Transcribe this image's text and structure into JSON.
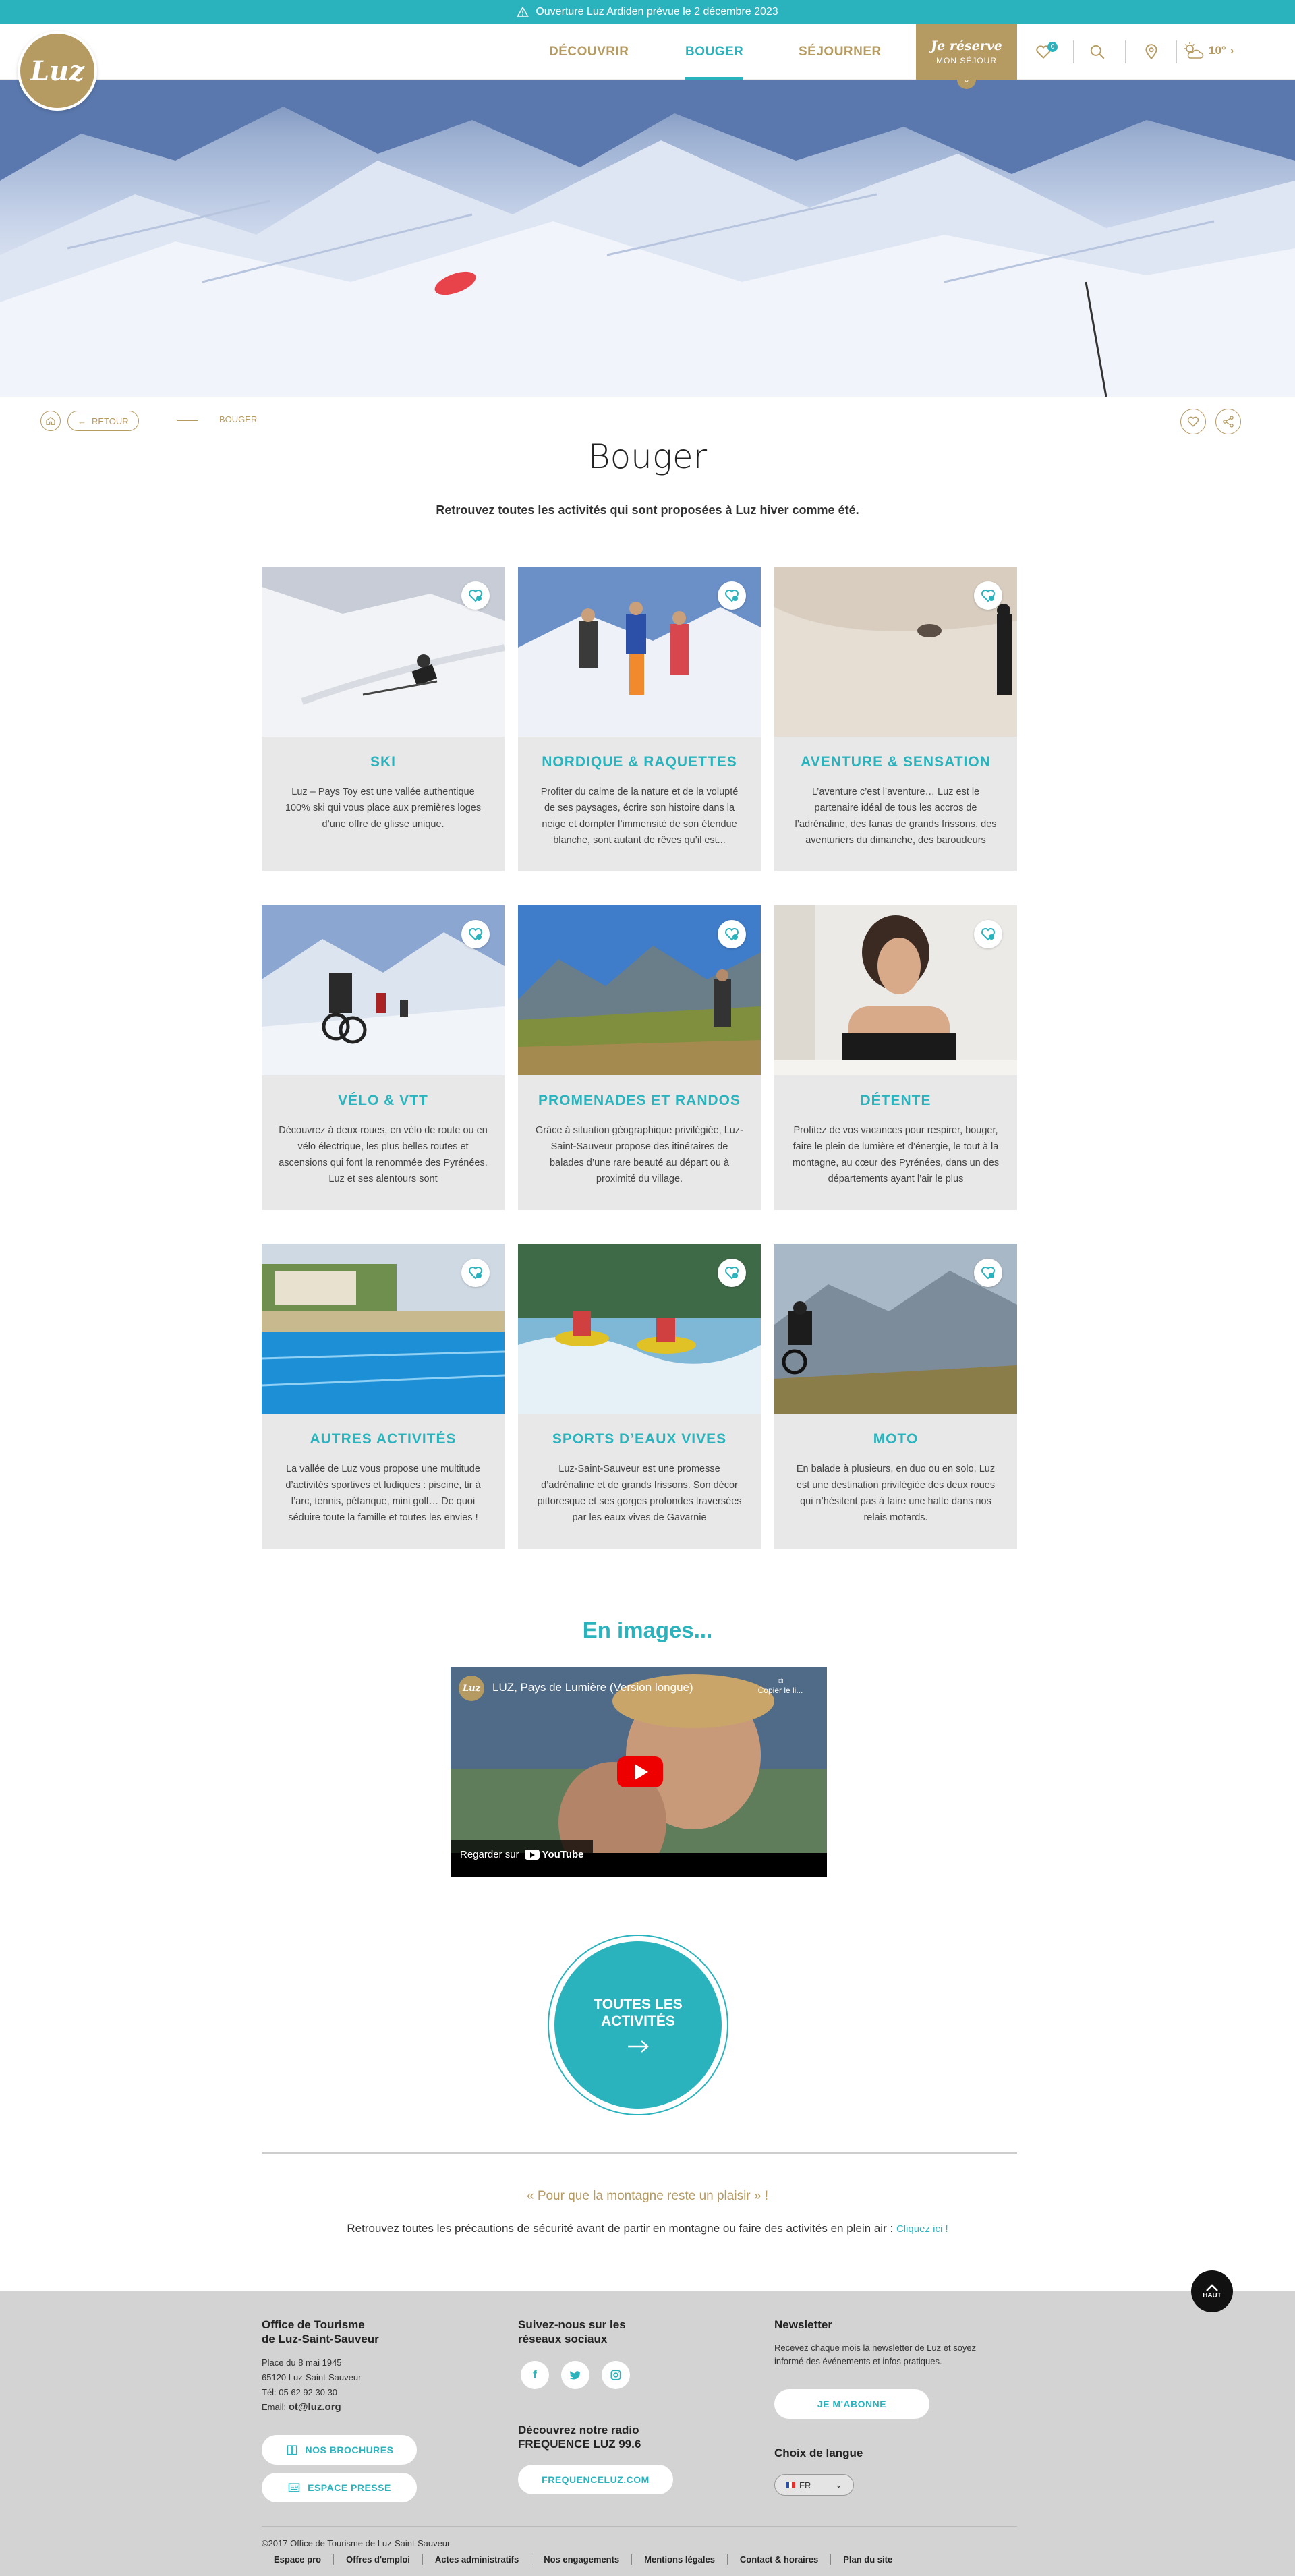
{
  "topbar": {
    "text": "Ouverture Luz Ardiden prévue le 2 décembre 2023"
  },
  "header": {
    "logo": "Luz",
    "nav": [
      {
        "label": "DÉCOUVRIR"
      },
      {
        "label": "BOUGER",
        "active": true
      },
      {
        "label": "SÉJOURNER"
      }
    ],
    "reserve": {
      "title": "Je réserve",
      "subtitle": "MON SÉJOUR"
    },
    "favorites_count": "0",
    "weather": {
      "temp": "10°"
    }
  },
  "breadcrumb": {
    "back": "RETOUR",
    "current": "BOUGER"
  },
  "page": {
    "title": "Bouger",
    "subtitle": "Retrouvez toutes les activités qui sont proposées à Luz hiver comme été."
  },
  "cards": [
    {
      "title": "SKI",
      "desc": "Luz – Pays Toy est une vallée authentique 100% ski qui vous place aux premières loges d’une offre de glisse unique."
    },
    {
      "title": "NORDIQUE & RAQUETTES",
      "desc": "Profiter du calme de la nature et de la volupté de ses paysages, écrire son histoire dans la neige et dompter l’immensité de son étendue blanche, sont autant de rêves qu’il est..."
    },
    {
      "title": "AVENTURE & SENSATION",
      "desc": "L’aventure c’est l’aventure… Luz est le partenaire idéal de tous les accros de l’adrénaline, des fanas de grands frissons, des aventuriers du dimanche, des baroudeurs"
    },
    {
      "title": "VÉLO & VTT",
      "desc": "Découvrez à deux roues, en vélo de route ou en vélo électrique, les plus belles routes et ascensions qui font la renommée des Pyrénées. Luz et ses alentours sont"
    },
    {
      "title": "PROMENADES ET RANDOS",
      "desc": "Grâce à situation géographique privilégiée, Luz-Saint-Sauveur propose des itinéraires de balades d’une rare beauté au départ ou à proximité du village."
    },
    {
      "title": "DÉTENTE",
      "desc": "Profitez de vos vacances pour respirer, bouger, faire le plein de lumière et d’énergie, le tout à la montagne, au cœur des Pyrénées, dans un des départements ayant l’air le plus"
    },
    {
      "title": "AUTRES ACTIVITÉS",
      "desc": "La vallée de Luz vous propose une multitude d’activités sportives et ludiques : piscine, tir à l’arc, tennis, pétanque, mini golf… De quoi séduire toute la famille et toutes les envies !"
    },
    {
      "title": "SPORTS D’EAUX VIVES",
      "desc": "Luz-Saint-Sauveur est une promesse d’adrénaline et de grands frissons. Son décor pittoresque et ses gorges profondes traversées par les eaux vives de Gavarnie"
    },
    {
      "title": "MOTO",
      "desc": "En balade à plusieurs, en duo ou en solo, Luz est une destination privilégiée des deux roues qui n’hésitent pas à faire une halte dans nos relais motards."
    }
  ],
  "images_section": {
    "title": "En images..."
  },
  "video": {
    "logo": "Luz",
    "title": "LUZ, Pays de Lumière (Version longue)",
    "copy": "Copier le li...",
    "watch": "Regarder sur",
    "brand": "YouTube"
  },
  "all_button": {
    "line1": "TOUTES LES",
    "line2": "ACTIVITÉS"
  },
  "safety": {
    "quote": "« Pour que la montagne reste un plaisir » !",
    "text": "Retrouvez toutes les précautions de sécurité avant de partir en montagne ou faire des activités en plein air :",
    "link": "Cliquez ici !"
  },
  "footer": {
    "to_top": "HAUT",
    "office": {
      "title1": "Office de Tourisme",
      "title2": "de Luz-Saint-Sauveur",
      "addr1": "Place du 8 mai 1945",
      "addr2": "65120 Luz-Saint-Sauveur",
      "tel": "Tél: 05 62 92 30 30",
      "email_label": "Email:",
      "email": "ot@luz.org",
      "brochures": "NOS BROCHURES",
      "presse": "ESPACE PRESSE"
    },
    "social": {
      "title1": "Suivez-nous sur les",
      "title2": "réseaux sociaux",
      "radio1": "Découvrez notre radio",
      "radio2": "FREQUENCE LUZ 99.6",
      "radio_button": "FREQUENCELUZ.COM"
    },
    "newsletter": {
      "title": "Newsletter",
      "text1": "Recevez chaque mois la newsletter de Luz et soyez",
      "text2": "informé des événements et infos pratiques.",
      "button": "JE M'ABONNE",
      "lang_title": "Choix de langue",
      "lang_value": "FR"
    },
    "copyright": "©2017 Office de Tourisme de Luz-Saint-Sauveur",
    "links": [
      "Espace pro",
      "Offres d'emploi",
      "Actes administratifs",
      "Nos engagements",
      "Mentions légales",
      "Contact & horaires",
      "Plan du site"
    ]
  }
}
